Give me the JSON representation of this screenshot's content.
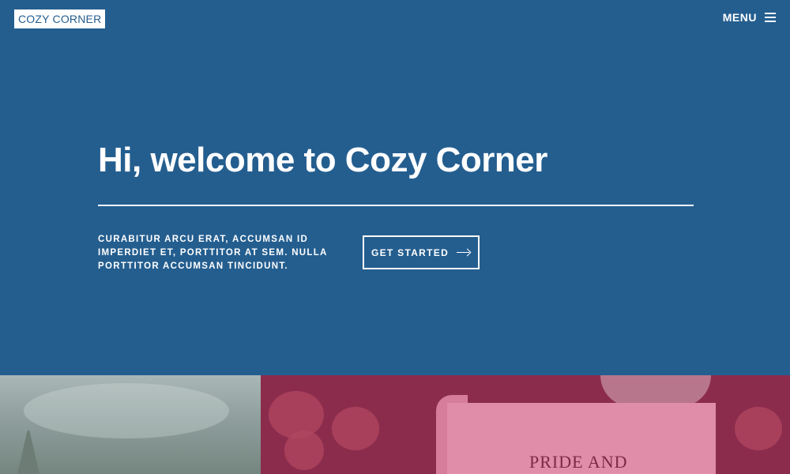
{
  "header": {
    "logo_text": "COZY CORNER",
    "menu_label": "MENU",
    "menu_icon": "hamburger-icon"
  },
  "hero": {
    "title": "Hi, welcome to Cozy Corner",
    "description": "Curabitur arcu erat, accumsan id imperdiet et, porttitor at sem. Nulla porttitor accumsan tincidunt.",
    "cta_label": "GET STARTED",
    "cta_icon": "arrow-right-icon"
  },
  "tiles": [
    {
      "type": "image",
      "subject": "cloudy-sky-with-spire"
    },
    {
      "type": "image",
      "subject": "book-with-roses",
      "caption": "PRIDE AND"
    }
  ],
  "colors": {
    "primary": "#245e8f",
    "logo_text": "#245e8f",
    "tile_right_tint": "#8c2c4d",
    "book": "#e08daa"
  }
}
